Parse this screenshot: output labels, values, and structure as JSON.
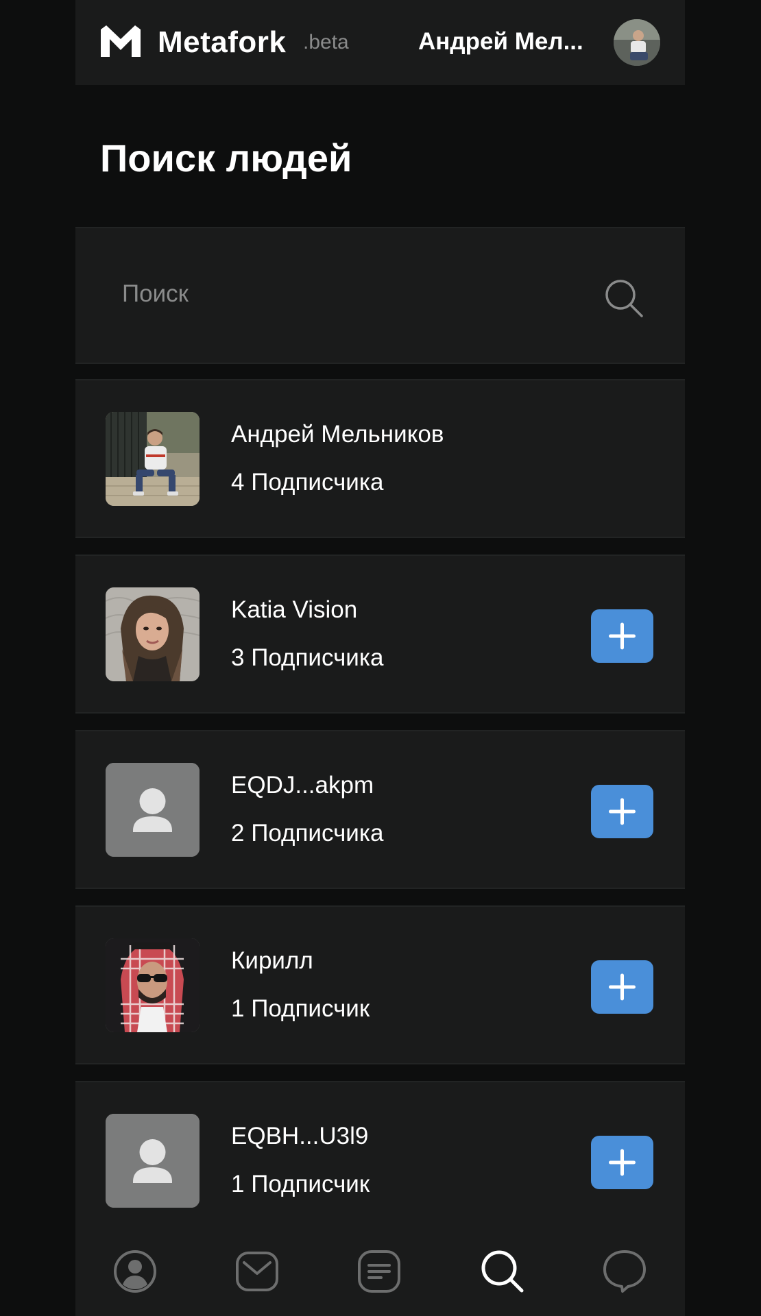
{
  "header": {
    "brand": "Metafork",
    "beta": ".beta",
    "user_name": "Андрей Мел..."
  },
  "page_title": "Поиск людей",
  "search": {
    "placeholder": "Поиск",
    "value": ""
  },
  "people": [
    {
      "name": "Андрей Мельников",
      "subscribers": "4 Подписчика",
      "avatar": "photo-man-on-stairs",
      "has_add": false
    },
    {
      "name": "Katia Vision",
      "subscribers": "3 Подписчика",
      "avatar": "photo-woman-long-hair",
      "has_add": true
    },
    {
      "name": "EQDJ...akpm",
      "subscribers": "2 Подписчика",
      "avatar": "default-user-icon",
      "has_add": true
    },
    {
      "name": "Кирилл",
      "subscribers": "1 Подписчик",
      "avatar": "photo-man-keffiyeh",
      "has_add": true
    },
    {
      "name": "EQBH...U3l9",
      "subscribers": "1 Подписчик",
      "avatar": "default-user-icon",
      "has_add": true
    }
  ],
  "nav": [
    {
      "icon": "profile-icon",
      "active": false
    },
    {
      "icon": "mail-icon",
      "active": false
    },
    {
      "icon": "feed-icon",
      "active": false
    },
    {
      "icon": "search-icon",
      "active": true
    },
    {
      "icon": "chat-bubble-icon",
      "active": false
    }
  ],
  "colors": {
    "background": "#0d0e0e",
    "panel": "#1a1b1b",
    "accent": "#4a8fd9",
    "muted": "#8a8b8b",
    "placeholder_avatar": "#7b7c7c"
  }
}
